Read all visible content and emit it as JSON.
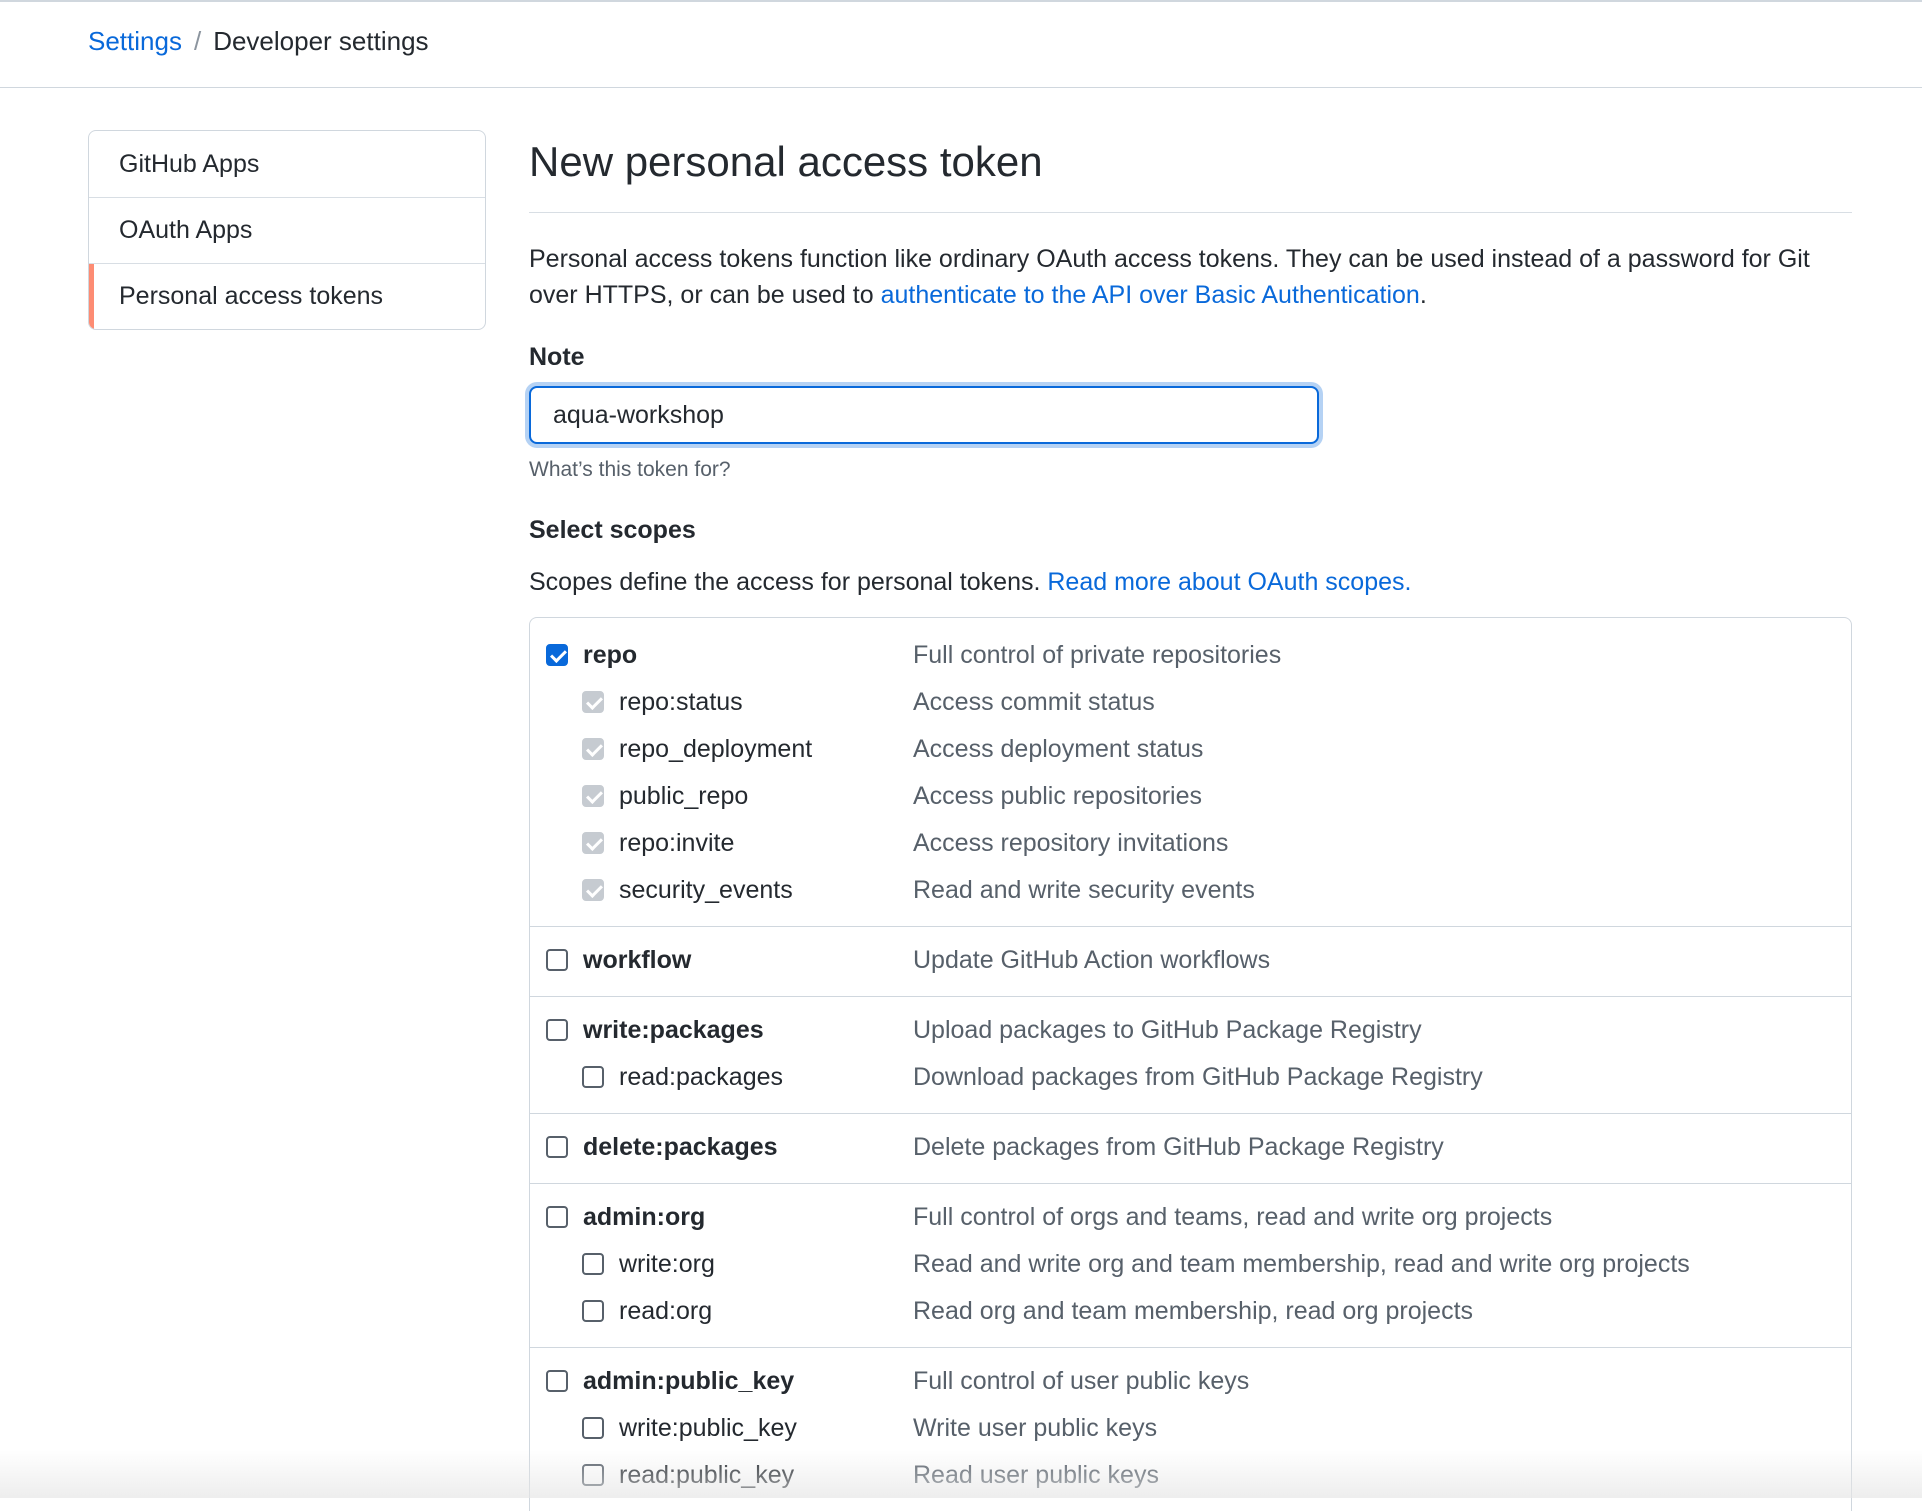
{
  "breadcrumb": {
    "parent": "Settings",
    "separator": "/",
    "current": "Developer settings"
  },
  "sidebar": {
    "items": [
      {
        "label": "GitHub Apps",
        "active": false
      },
      {
        "label": "OAuth Apps",
        "active": false
      },
      {
        "label": "Personal access tokens",
        "active": true
      }
    ]
  },
  "main": {
    "title": "New personal access token",
    "intro_text": "Personal access tokens function like ordinary OAuth access tokens. They can be used instead of a password for Git over HTTPS, or can be used to ",
    "intro_link": "authenticate to the API over Basic Authentication",
    "intro_end": ".",
    "note_label": "Note",
    "note_value": "aqua-workshop",
    "note_hint": "What’s this token for?",
    "scopes_label": "Select scopes",
    "scopes_intro": "Scopes define the access for personal tokens. ",
    "scopes_link": "Read more about OAuth scopes."
  },
  "scopes": [
    {
      "name": "repo",
      "desc": "Full control of private repositories",
      "checked": true,
      "children": [
        {
          "name": "repo:status",
          "desc": "Access commit status",
          "checked": true
        },
        {
          "name": "repo_deployment",
          "desc": "Access deployment status",
          "checked": true
        },
        {
          "name": "public_repo",
          "desc": "Access public repositories",
          "checked": true
        },
        {
          "name": "repo:invite",
          "desc": "Access repository invitations",
          "checked": true
        },
        {
          "name": "security_events",
          "desc": "Read and write security events",
          "checked": true
        }
      ]
    },
    {
      "name": "workflow",
      "desc": "Update GitHub Action workflows",
      "checked": false,
      "children": []
    },
    {
      "name": "write:packages",
      "desc": "Upload packages to GitHub Package Registry",
      "checked": false,
      "children": [
        {
          "name": "read:packages",
          "desc": "Download packages from GitHub Package Registry",
          "checked": false
        }
      ]
    },
    {
      "name": "delete:packages",
      "desc": "Delete packages from GitHub Package Registry",
      "checked": false,
      "children": []
    },
    {
      "name": "admin:org",
      "desc": "Full control of orgs and teams, read and write org projects",
      "checked": false,
      "children": [
        {
          "name": "write:org",
          "desc": "Read and write org and team membership, read and write org projects",
          "checked": false
        },
        {
          "name": "read:org",
          "desc": "Read org and team membership, read org projects",
          "checked": false
        }
      ]
    },
    {
      "name": "admin:public_key",
      "desc": "Full control of user public keys",
      "checked": false,
      "children": [
        {
          "name": "write:public_key",
          "desc": "Write user public keys",
          "checked": false
        },
        {
          "name": "read:public_key",
          "desc": "Read user public keys",
          "checked": false
        }
      ]
    }
  ]
}
